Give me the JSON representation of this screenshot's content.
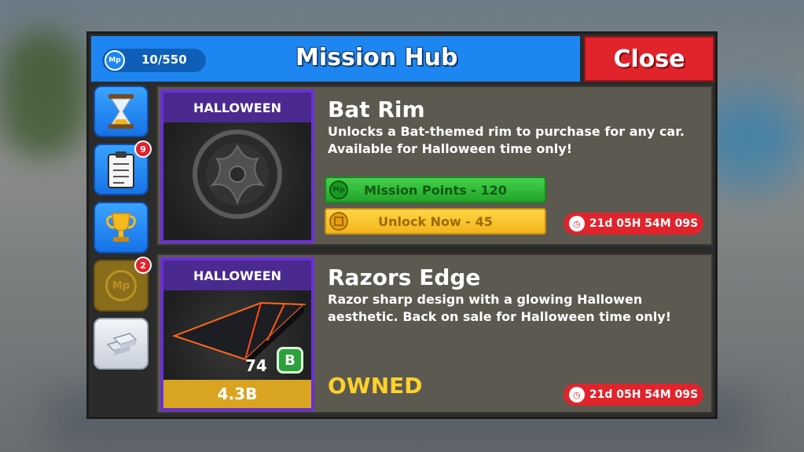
{
  "hub": {
    "points_value": "10/550",
    "points_icon_label": "Mp",
    "title": "Mission Hub",
    "close_label": "Close"
  },
  "sidebar": {
    "items": [
      {
        "icon": "hourglass-icon",
        "badge": ""
      },
      {
        "icon": "clipboard-icon",
        "badge": "9"
      },
      {
        "icon": "trophy-icon",
        "badge": ""
      },
      {
        "icon": "mission-points-icon",
        "badge": "2",
        "icon_label": "Mp"
      },
      {
        "icon": "silver-bars-icon",
        "badge": ""
      }
    ]
  },
  "missions": [
    {
      "tag": "HALLOWEEN",
      "title": "Bat Rim",
      "description": "Unlocks a Bat-themed rim to purchase for any car. Available for Halloween time only!",
      "mission_points_label": "Mission Points - 120",
      "unlock_label": "Unlock Now - 45",
      "timer": "21d 05H 54M 09S"
    },
    {
      "tag": "HALLOWEEN",
      "title": "Razors Edge",
      "description": "Razor sharp design with a glowing Hallowen aesthetic. Back on sale for Halloween time only!",
      "status": "OWNED",
      "quantity": "74",
      "b_badge": "B",
      "price": "4.3B",
      "timer": "21d 05H 54M 09S"
    }
  ],
  "colors": {
    "header_blue": "#1e86f0",
    "close_red": "#e1232b",
    "owned_yellow": "#ffd12a",
    "tag_purple": "#6a2fd6"
  }
}
